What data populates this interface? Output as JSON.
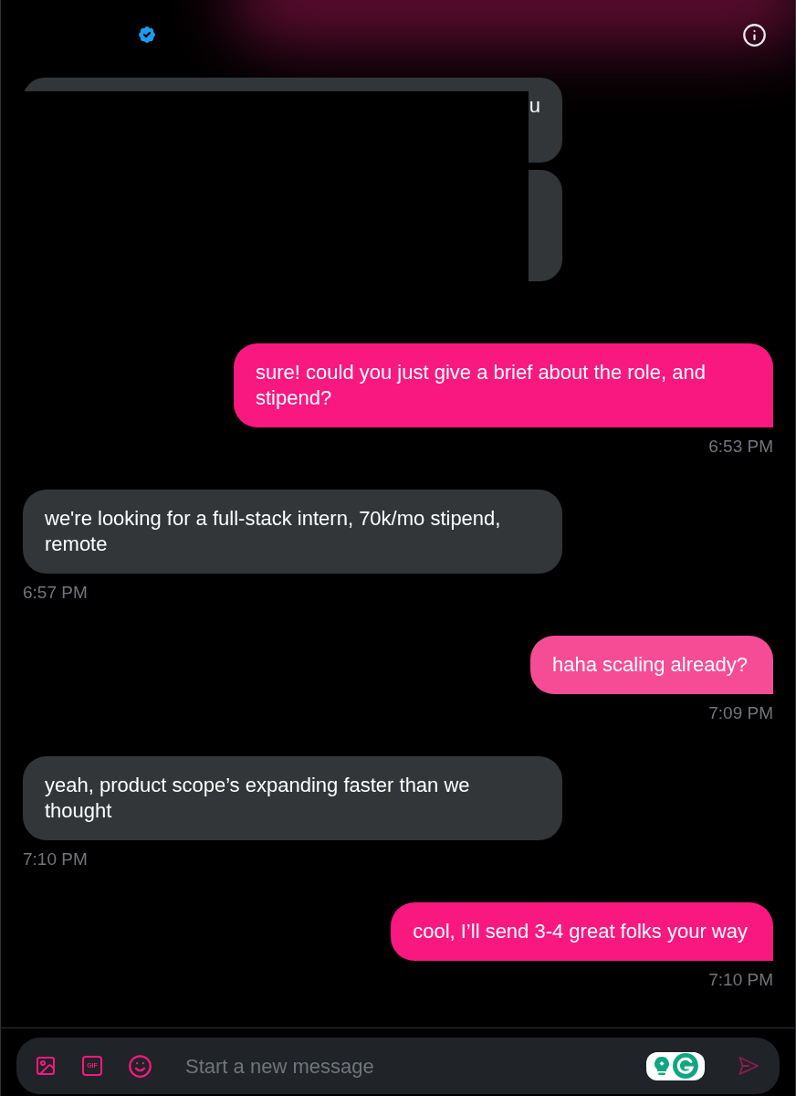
{
  "header": {
    "verified": true
  },
  "redacted_group": {
    "bubbles": [
      {
        "kind": "partial",
        "fragment": "u"
      },
      {
        "kind": "hidden"
      }
    ]
  },
  "messages": [
    {
      "kind": "sent",
      "text": "sure! could you just give a brief about the role, and stipend?",
      "color": "#f91880",
      "time": "6:53 PM"
    },
    {
      "kind": "received",
      "text": "we're looking for a full-stack intern, 70k/mo stipend, remote",
      "color": "#333639",
      "time": "6:57 PM"
    },
    {
      "kind": "sent",
      "text": "haha scaling already?",
      "color": "#f64c96",
      "time": "7:09 PM"
    },
    {
      "kind": "received",
      "text": "yeah, product scope’s expanding faster than we thought",
      "color": "#333639",
      "time": "7:10 PM"
    },
    {
      "kind": "sent",
      "text": "cool, I’ll send 3-4 great folks your way",
      "color": "#f91880",
      "time": "7:10 PM"
    }
  ],
  "composer": {
    "placeholder": "Start a new message",
    "gif_label": "GIF",
    "send_disabled": true
  }
}
